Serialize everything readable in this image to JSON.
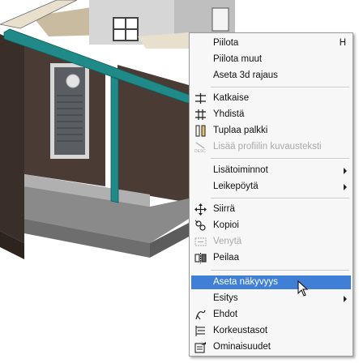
{
  "menu": {
    "items": [
      {
        "label": "Piilota",
        "shortcut": "H",
        "icon": "",
        "enabled": true,
        "submenu": false
      },
      {
        "label": "Piilota muut",
        "icon": "",
        "enabled": true,
        "submenu": false
      },
      {
        "label": "Aseta 3d rajaus",
        "icon": "",
        "enabled": true,
        "submenu": false
      },
      {
        "label": "Katkaise",
        "icon": "cut-beam-icon",
        "enabled": true,
        "submenu": false
      },
      {
        "label": "Yhdistä",
        "icon": "join-beam-icon",
        "enabled": true,
        "submenu": false
      },
      {
        "label": "Tuplaa palkki",
        "icon": "double-beam-icon",
        "enabled": true,
        "submenu": false
      },
      {
        "label": "Lisää profiilin kuvausteksti",
        "icon": "profile-description-icon",
        "enabled": false,
        "submenu": false
      },
      {
        "label": "Lisätoiminnot",
        "icon": "",
        "enabled": true,
        "submenu": true
      },
      {
        "label": "Leikepöytä",
        "icon": "",
        "enabled": true,
        "submenu": true
      },
      {
        "label": "Siirrä",
        "icon": "move-icon",
        "enabled": true,
        "submenu": false
      },
      {
        "label": "Kopioi",
        "icon": "copy-icon",
        "enabled": true,
        "submenu": false
      },
      {
        "label": "Venytä",
        "icon": "stretch-icon",
        "enabled": false,
        "submenu": false
      },
      {
        "label": "Peilaa",
        "icon": "mirror-icon",
        "enabled": true,
        "submenu": false
      },
      {
        "label": "Aseta näkyvyys",
        "icon": "",
        "enabled": true,
        "submenu": false,
        "highlighted": true
      },
      {
        "label": "Esitys",
        "icon": "",
        "enabled": true,
        "submenu": true
      },
      {
        "label": "Ehdot",
        "icon": "conditions-icon",
        "enabled": true,
        "submenu": false
      },
      {
        "label": "Korkeustasot",
        "icon": "height-levels-icon",
        "enabled": true,
        "submenu": false
      },
      {
        "label": "Ominaisuudet",
        "icon": "properties-icon",
        "enabled": true,
        "submenu": false
      }
    ]
  },
  "colors": {
    "highlight": "#3f7fd6",
    "beam": "#1f8a87",
    "wall": "#4a3b34",
    "floor": "#8a8a8a"
  }
}
